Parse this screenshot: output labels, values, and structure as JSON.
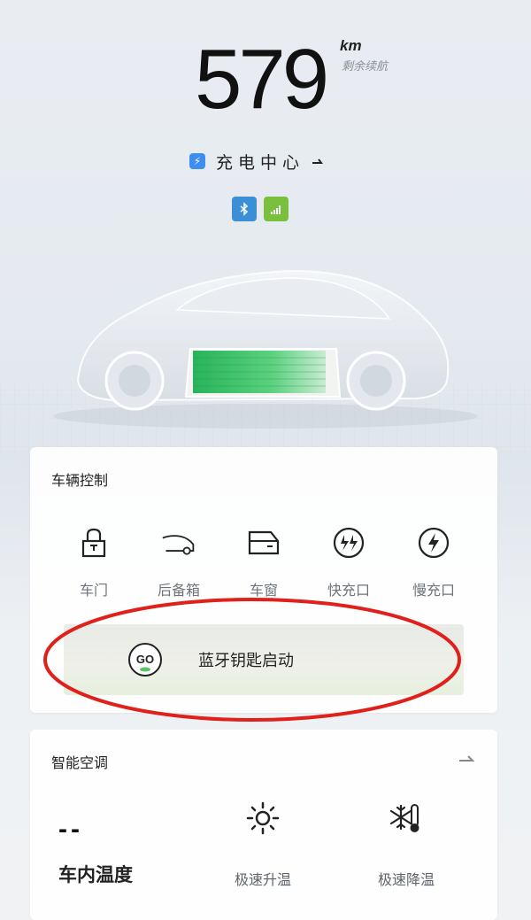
{
  "range": {
    "value": "579",
    "unit": "km",
    "label": "剩余续航"
  },
  "charge_center": {
    "label": "充电中心",
    "icon": "lightning-icon",
    "arrow_icon": "arrow-right-icon"
  },
  "status_icons": [
    {
      "name": "bluetooth-icon"
    },
    {
      "name": "signal-icon"
    }
  ],
  "vehicle_control": {
    "title": "车辆控制",
    "items": [
      {
        "label": "车门",
        "icon": "lock-icon"
      },
      {
        "label": "后备箱",
        "icon": "trunk-icon"
      },
      {
        "label": "车窗",
        "icon": "window-icon"
      },
      {
        "label": "快充口",
        "icon": "fast-charge-icon"
      },
      {
        "label": "慢充口",
        "icon": "slow-charge-icon"
      }
    ],
    "bluetooth_start": {
      "label": "蓝牙钥匙启动",
      "badge": "GO",
      "icon": "go-icon"
    }
  },
  "smart_ac": {
    "title": "智能空调",
    "temperature_value": "--",
    "temperature_label": "车内温度",
    "actions": [
      {
        "label": "极速升温",
        "icon": "sun-icon"
      },
      {
        "label": "极速降温",
        "icon": "snowflake-thermometer-icon"
      }
    ]
  },
  "colors": {
    "accent_blue": "#3d8ef0",
    "battery_green": "#3cc26a",
    "highlight_red": "#e0201a",
    "signal_green": "#7bbf3e"
  }
}
